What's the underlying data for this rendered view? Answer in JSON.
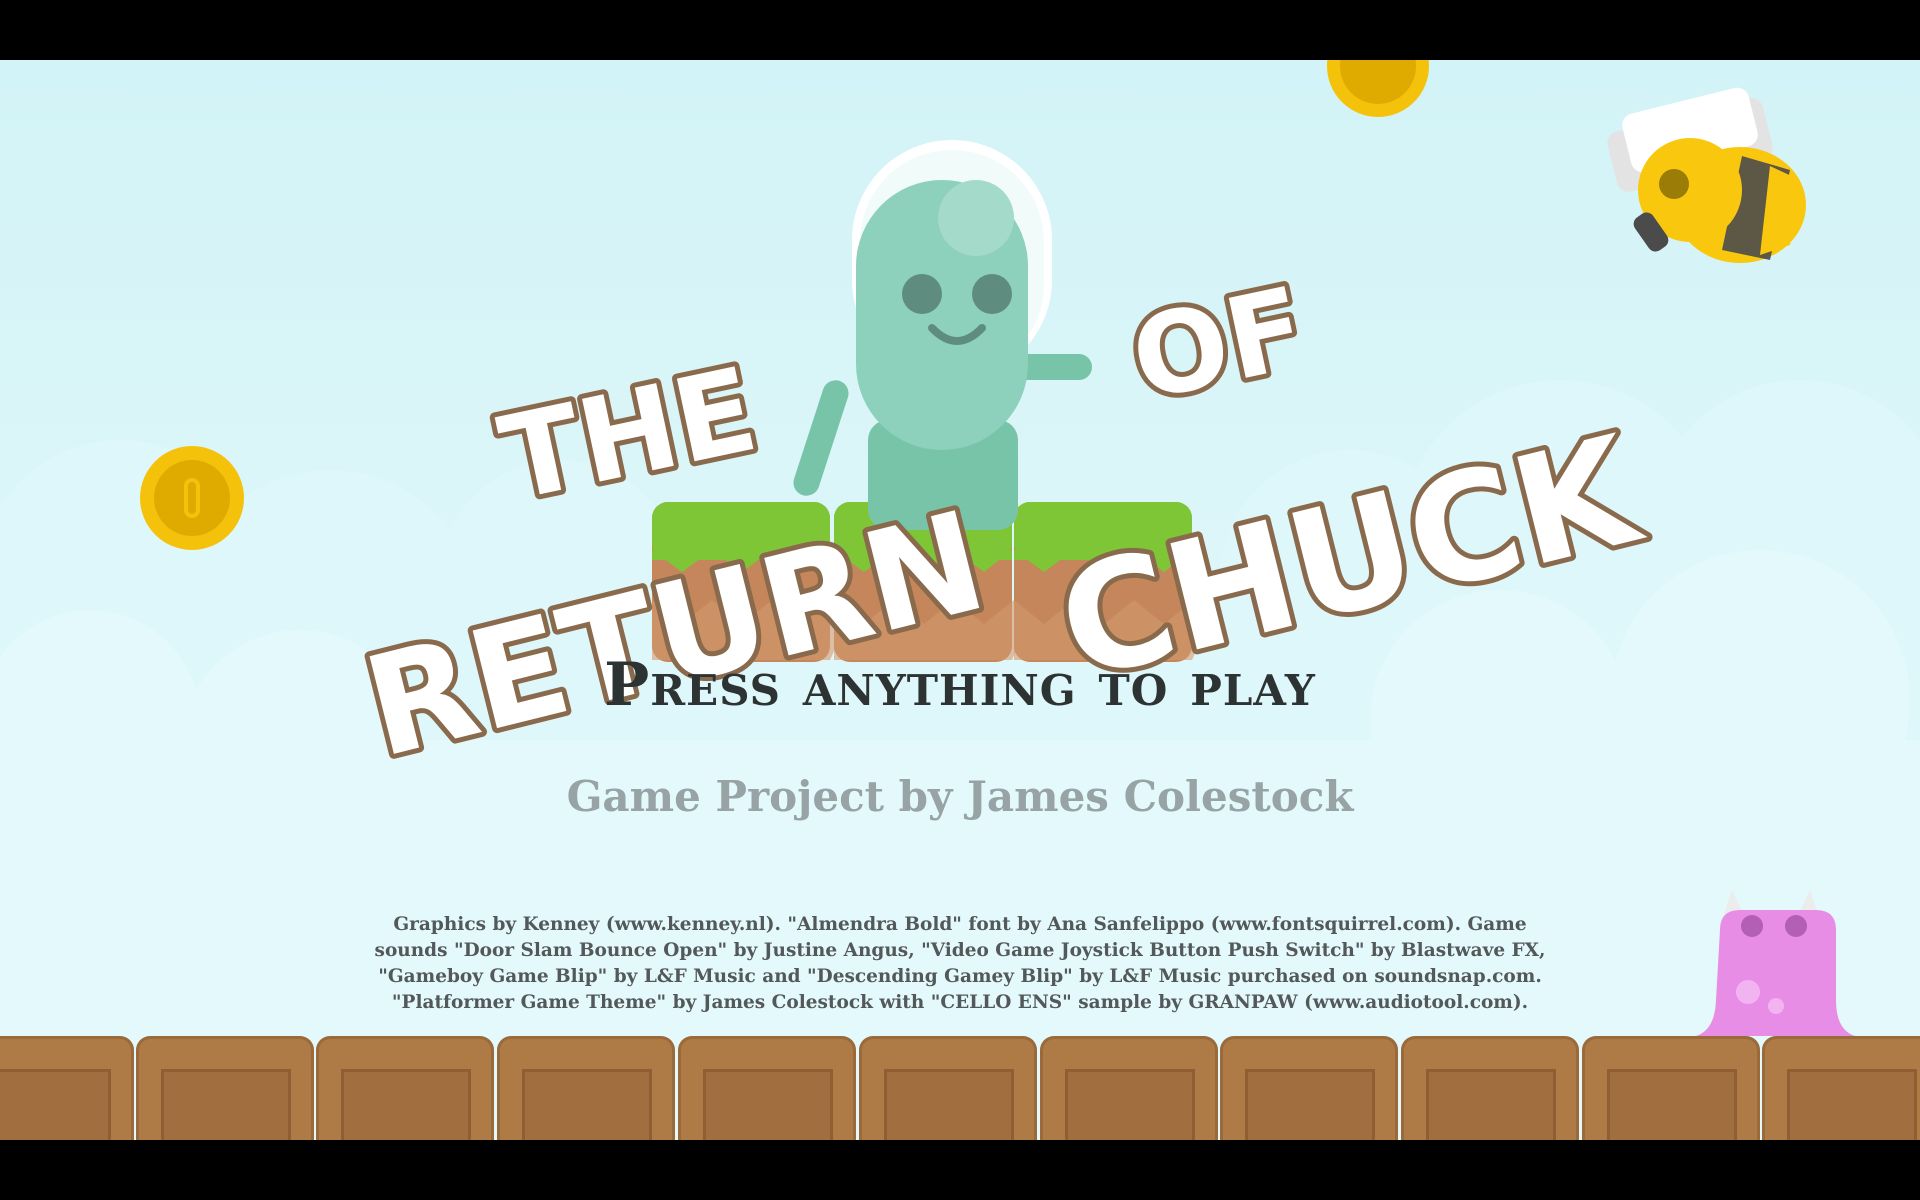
{
  "title": {
    "line1_the": "THE",
    "line1_of": "OF",
    "line2_return": "RETURN",
    "line2_chuck": "CHUCK"
  },
  "prompt": "Press anything to play",
  "byline": "Game Project by James Colestock",
  "credits": "Graphics by Kenney (www.kenney.nl).  \"Almendra Bold\" font by Ana Sanfelippo (www.fontsquirrel.com).  Game sounds \"Door Slam Bounce Open\" by Justine Angus, \"Video Game Joystick Button Push Switch\" by Blastwave FX, \"Gameboy Game Blip\" by L&F Music and \"Descending Gamey Blip\" by L&F Music purchased on soundsnap.com.  \"Platformer Game Theme\" by James Colestock with \"CELLO ENS\" sample by GRANPAW (www.audiotool.com).",
  "sprites": {
    "player": "alien-astronaut",
    "enemy_flying": "bee",
    "enemy_ground": "pink-slime",
    "collectible": "gold-coin",
    "platform": "grass-dirt-block",
    "ground": "wooden-crate"
  },
  "colors": {
    "sky": "#d2f3f7",
    "title_fill": "#ffffff",
    "title_outline": "#8a6a4c",
    "prompt_text": "#2d3233",
    "byline_text": "#97a3a5",
    "credits_text": "#53585a",
    "grass": "#7ec636",
    "dirt": "#c4865a",
    "crate": "#ae7a45",
    "coin": "#f5c20b",
    "alien": "#78c4a8",
    "bee_yellow": "#f9c80e",
    "slime": "#e78de6"
  }
}
